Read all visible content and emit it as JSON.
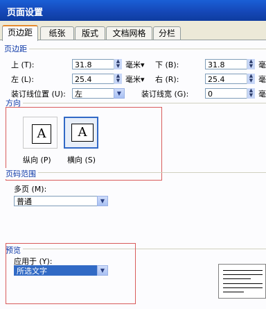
{
  "window": {
    "title": "页面设置"
  },
  "tabs": [
    "页边距",
    "纸张",
    "版式",
    "文档网格",
    "分栏"
  ],
  "margins": {
    "section_label": "页边距",
    "top_label": "上 (T):",
    "top_value": "31.8",
    "top_unit": "毫米",
    "bottom_label": "下 (B):",
    "bottom_value": "31.8",
    "left_label": "左 (L):",
    "left_value": "25.4",
    "left_unit": "毫米",
    "right_label": "右 (R):",
    "right_value": "25.4",
    "gutter_pos_label": "装订线位置 (U):",
    "gutter_pos_value": "左",
    "gutter_label": "装订线宽 (G):",
    "gutter_value": "0"
  },
  "orientation": {
    "section_label": "方向",
    "portrait_label": "纵向 (P)",
    "landscape_label": "横向 (S)",
    "glyph": "A",
    "selected": "landscape"
  },
  "pages": {
    "section_label": "页码范围",
    "multi_label": "多页 (M):",
    "multi_value": "普通"
  },
  "preview": {
    "section_label": "预览",
    "apply_label": "应用于 (Y):",
    "apply_value": "所选文字"
  }
}
